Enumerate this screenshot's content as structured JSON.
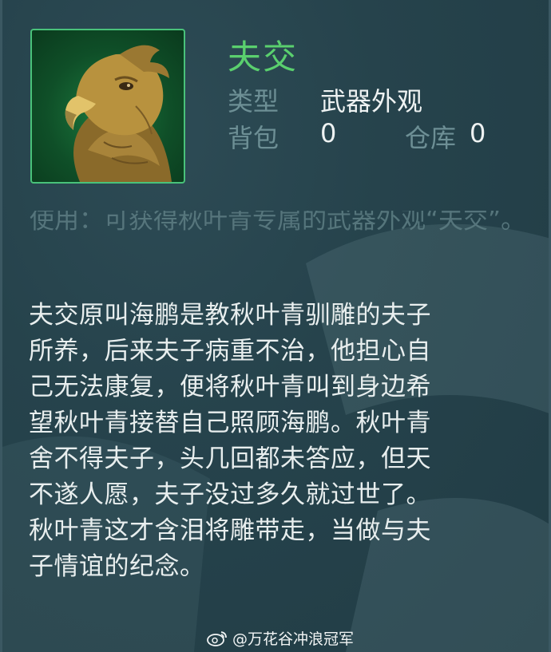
{
  "item": {
    "name": "夫交",
    "icon": "eagle-portrait-icon",
    "type_label": "类型",
    "type_value": "武器外观",
    "bag_label": "背包",
    "bag_value": "0",
    "warehouse_label": "仓库",
    "warehouse_value": "0"
  },
  "usage": {
    "text": "使用：可获得秋叶青专属的武器外观“夫交”。"
  },
  "description": {
    "lines": [
      "夫交原叫海鹏是教秋叶青驯雕的夫子",
      "所养，后来夫子病重不治，他担心自",
      "己无法康复，便将秋叶青叫到身边希",
      "望秋叶青接替自己照顾海鹏。秋叶青",
      "舍不得夫子，头几回都未答应，但天",
      "不遂人愿，夫子没过多久就过世了。",
      "秋叶青这才含泪将雕带走，当做与夫",
      "子情谊的纪念。"
    ]
  },
  "watermark": {
    "text": "@万花谷冲浪冠军",
    "icon": "weibo-logo-icon"
  },
  "colors": {
    "background": "#26434c",
    "name_green": "#5ad06e",
    "label_gray": "#6d8f95",
    "text_white": "#e8eeee",
    "frame_green": "#49c27a"
  }
}
